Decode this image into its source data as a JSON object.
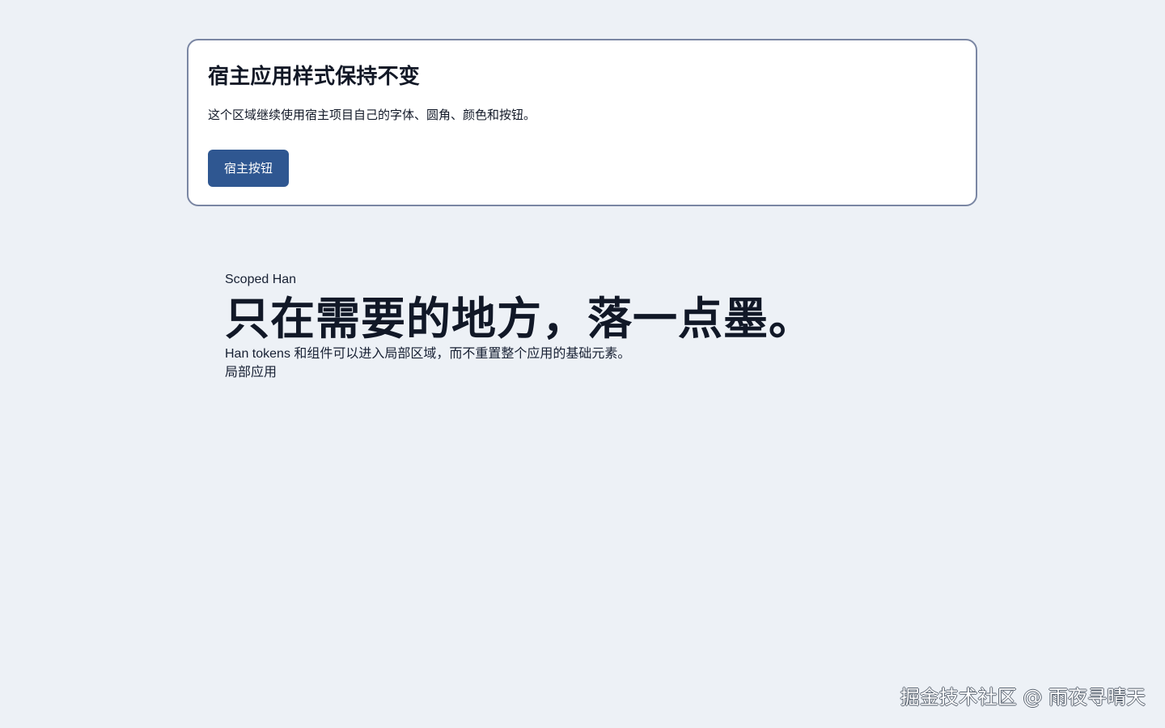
{
  "host_card": {
    "title": "宿主应用样式保持不变",
    "description": "这个区域继续使用宿主项目自己的字体、圆角、颜色和按钮。",
    "button_label": "宿主按钮"
  },
  "scoped_section": {
    "eyebrow": "Scoped Han",
    "headline": "只在需要的地方，落一点墨。",
    "description": "Han tokens 和组件可以进入局部区域，而不重置整个应用的基础元素。",
    "local_label": "局部应用"
  },
  "watermark": {
    "text": "掘金技术社区 @ 雨夜寻晴天"
  },
  "colors": {
    "page_background": "#edf1f6",
    "card_border": "#7a86a3",
    "button_background": "#2f5791",
    "text": "#111827"
  }
}
